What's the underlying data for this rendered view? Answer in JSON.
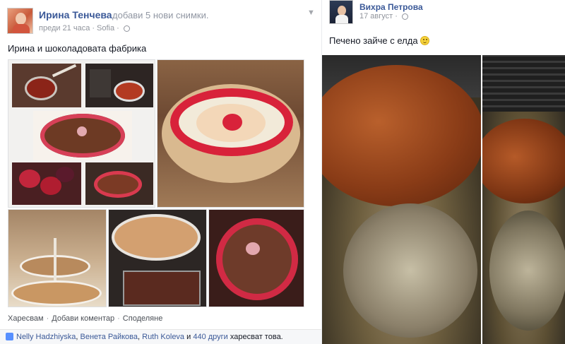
{
  "left_post": {
    "author": "Ирина Тенчева",
    "action": "добави 5 нови снимки.",
    "time": "преди 21 часа",
    "location": "Sofia",
    "caption": "Ирина и шоколадовата фабрика",
    "actions": {
      "like": "Харесвам",
      "comment": "Добави коментар",
      "share": "Споделяне",
      "separator": "·"
    },
    "likes": {
      "names": [
        "Nelly Hadzhiyska",
        "Венета Райкова",
        "Ruth Koleva"
      ],
      "sep1": ",",
      "sep2": ",",
      "and": "и",
      "others": "440 други",
      "suffix": "харесват това."
    }
  },
  "right_post": {
    "author": "Вихра Петрова",
    "time": "17 август",
    "caption": "Печено зайче с елда"
  },
  "icons": {
    "menu": "chevron-down-icon",
    "privacy": "globe-icon",
    "emoji": "smile-emoji",
    "like": "thumbs-up-icon"
  },
  "colors": {
    "link": "#3b5998",
    "meta": "#90949c",
    "background": "#e9ebee"
  }
}
